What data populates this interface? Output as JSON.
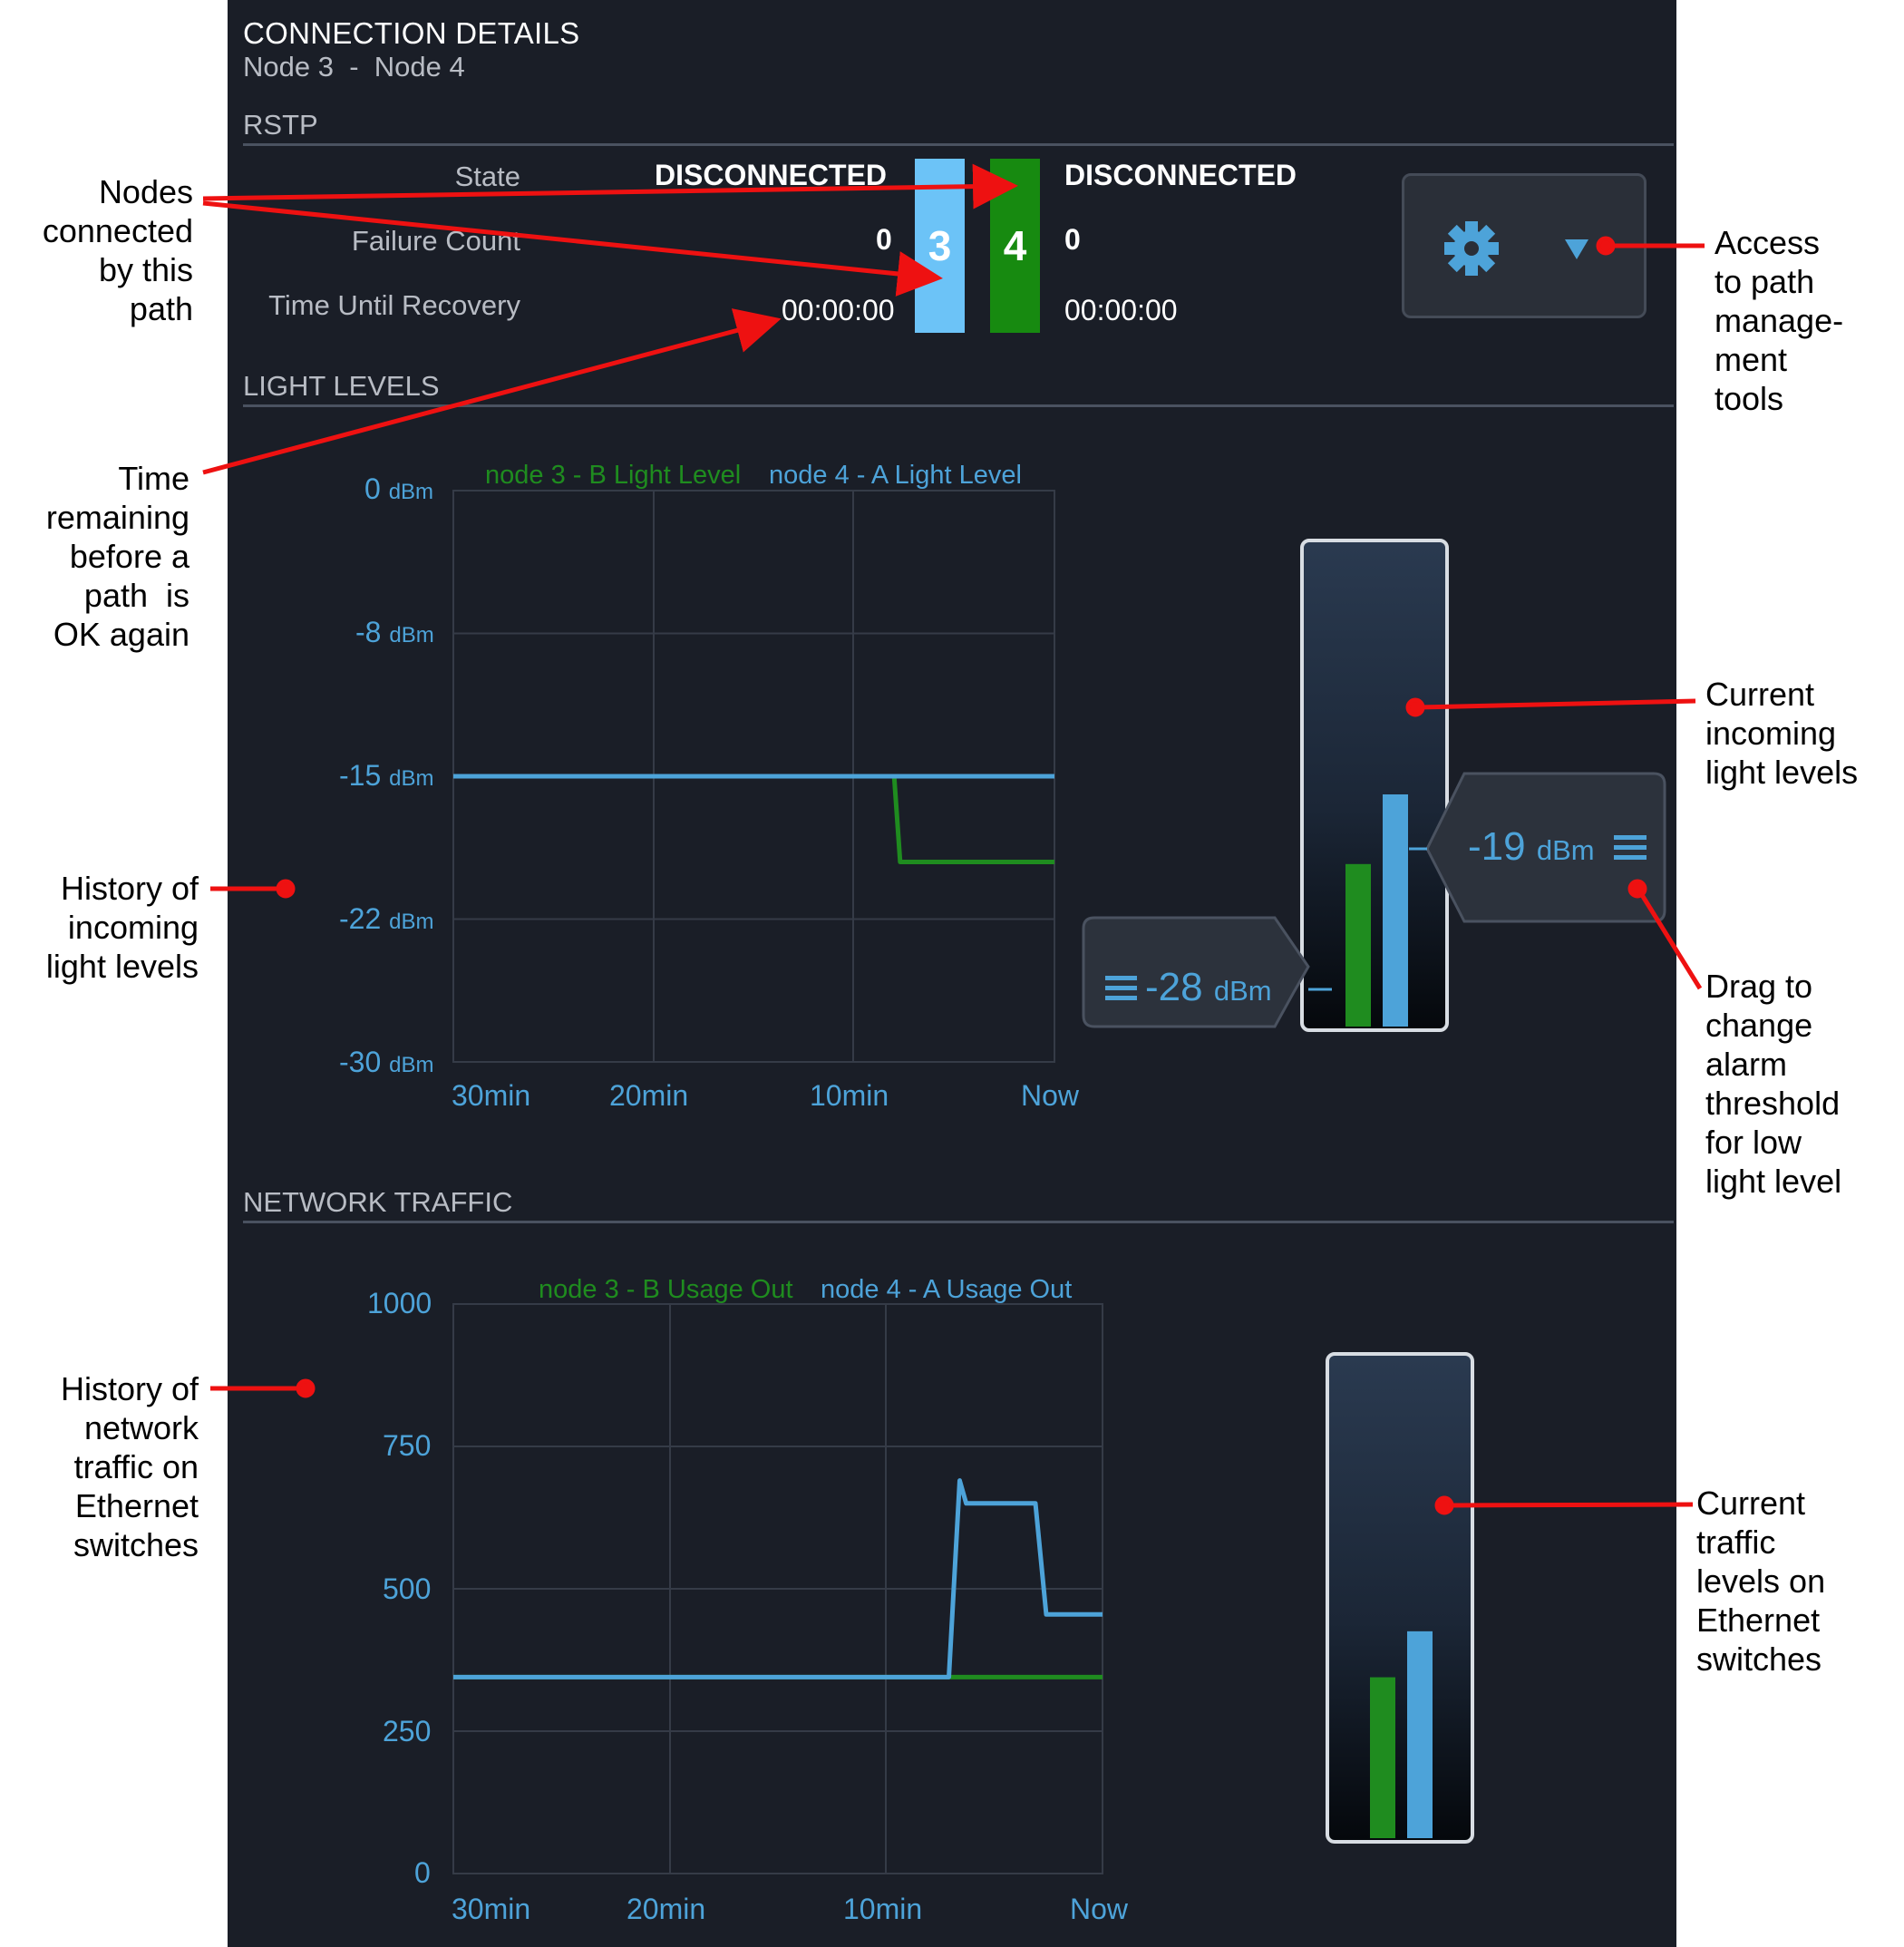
{
  "header": {
    "title": "CONNECTION DETAILS",
    "subtitle": "Node 3  -  Node 4"
  },
  "rstp": {
    "section_title": "RSTP",
    "labels": {
      "state": "State",
      "failure_count": "Failure Count",
      "time_until_recovery": "Time Until Recovery"
    },
    "left": {
      "state": "DISCONNECTED",
      "failure_count": "0",
      "time_until_recovery": "00:00:00"
    },
    "right": {
      "state": "DISCONNECTED",
      "failure_count": "0",
      "time_until_recovery": "00:00:00"
    },
    "nodes": [
      {
        "number": "3",
        "color": "#6cc3f7"
      },
      {
        "number": "4",
        "color": "#178a10"
      }
    ],
    "tools": {
      "icons": [
        "gear-icon",
        "dropdown-arrow-icon"
      ]
    }
  },
  "light_levels": {
    "section_title": "LIGHT LEVELS",
    "legend": [
      "node 3 - B Light Level",
      "node 4 - A Light Level"
    ],
    "unit": "dBm",
    "y_ticks": [
      "0",
      "-8",
      "-15",
      "-22",
      "-30"
    ],
    "x_ticks": [
      "30min",
      "20min",
      "10min",
      "Now"
    ],
    "low_alarm": {
      "value": "-28",
      "unit": "dBm"
    },
    "high_alarm": {
      "value": "-19",
      "unit": "dBm"
    }
  },
  "network_traffic": {
    "section_title": "NETWORK TRAFFIC",
    "legend": [
      "node 3 - B Usage Out",
      "node 4 - A Usage Out"
    ],
    "y_ticks": [
      "1000",
      "750",
      "500",
      "250",
      "0"
    ],
    "x_ticks": [
      "30min",
      "20min",
      "10min",
      "Now"
    ]
  },
  "chart_data": [
    {
      "type": "line",
      "xlabel": "",
      "ylabel": "",
      "x": [
        "30min",
        "20min",
        "10min",
        "Now"
      ],
      "ylim": [
        -30,
        0
      ],
      "series": [
        {
          "name": "node 3 - B Light Level",
          "color": "#1f8c1f",
          "points": [
            [
              30,
              -15
            ],
            [
              8,
              -15
            ],
            [
              7.7,
              -19.5
            ],
            [
              0,
              -19.5
            ]
          ]
        },
        {
          "name": "node 4 - A Light Level",
          "color": "#4da3d9",
          "points": [
            [
              30,
              -15
            ],
            [
              0,
              -15
            ]
          ]
        }
      ],
      "current_bars": [
        {
          "series": "node 3 - B Light Level",
          "value": -19.5
        },
        {
          "series": "node 4 - A Light Level",
          "value": -15
        }
      ]
    },
    {
      "type": "line",
      "xlabel": "",
      "ylabel": "",
      "x": [
        "30min",
        "20min",
        "10min",
        "Now"
      ],
      "ylim": [
        0,
        1000
      ],
      "series": [
        {
          "name": "node 3 - B Usage Out",
          "color": "#1f8c1f",
          "points": [
            [
              30,
              345
            ],
            [
              0,
              345
            ]
          ]
        },
        {
          "name": "node 4 - A Usage Out",
          "color": "#4da3d9",
          "points": [
            [
              30,
              345
            ],
            [
              7.1,
              345
            ],
            [
              6.6,
              690
            ],
            [
              6.3,
              650
            ],
            [
              3.1,
              650
            ],
            [
              2.6,
              455
            ],
            [
              0,
              455
            ]
          ]
        }
      ],
      "current_bars": [
        {
          "series": "node 3 - B Usage Out",
          "value": 350
        },
        {
          "series": "node 4 - A Usage Out",
          "value": 450
        }
      ]
    }
  ],
  "annotations": {
    "nodes": "Nodes\nconnected\nby this\npath",
    "time": "Time\nremaining\nbefore a\npath  is\nOK again",
    "history_light": "History of\nincoming\nlight levels",
    "history_traffic": "History of\nnetwork\ntraffic on\nEthernet\nswitches",
    "access": "Access\nto path\nmanage-\nment\ntools",
    "current_light": "Current\nincoming\nlight levels",
    "drag": "Drag to\nchange\nalarm\nthreshold\nfor low\nlight level",
    "current_traffic": "Current\ntraffic\nlevels on\nEthernet\nswitches"
  }
}
